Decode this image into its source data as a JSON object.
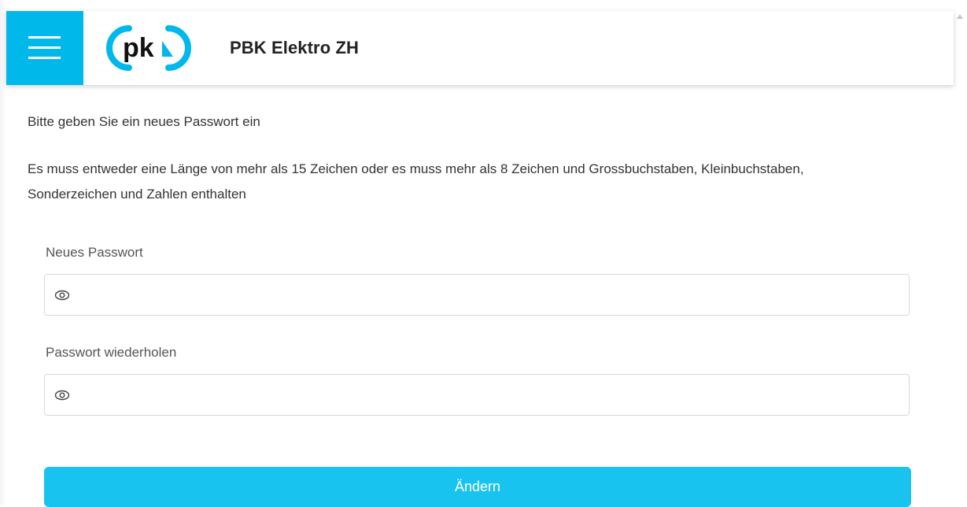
{
  "header": {
    "app_title": "PBK Elektro ZH",
    "logo_text": "pk",
    "brand_color": "#00b8ea"
  },
  "form": {
    "intro": "Bitte geben Sie ein neues Passwort ein",
    "rules": "Es muss entweder eine Länge von mehr als 15 Zeichen oder es muss mehr als 8 Zeichen und Grossbuchstaben, Kleinbuchstaben, Sonderzeichen und Zahlen enthalten",
    "new_password": {
      "label": "Neues Passwort",
      "value": "",
      "icon": "eye-icon"
    },
    "repeat_password": {
      "label": "Passwort wiederholen",
      "value": "",
      "icon": "eye-icon"
    },
    "submit_label": "Ändern",
    "submit_color": "#19c3f0"
  }
}
